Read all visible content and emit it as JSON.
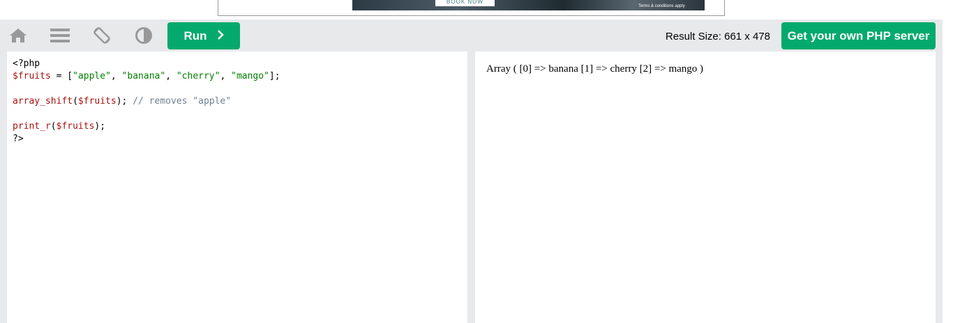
{
  "ad": {
    "button_label": "BOOK NOW",
    "terms": "Terms & conditions apply"
  },
  "toolbar": {
    "icons": [
      "home-icon",
      "menu-icon",
      "rotate-icon",
      "contrast-icon"
    ],
    "run_label": "Run",
    "result_size": "Result Size: 661 x 478",
    "server_label": "Get your own PHP server"
  },
  "editor": {
    "line1": "<?php",
    "line2_var": "$fruits",
    "line2_op": " = [",
    "line2_s1": "\"apple\"",
    "line2_s2": "\"banana\"",
    "line2_s3": "\"cherry\"",
    "line2_s4": "\"mango\"",
    "line2_end": "];",
    "line4_fn": "array_shift",
    "line4_arg": "$fruits",
    "line4_cmt": "// removes \"apple\"",
    "line6_fn": "print_r",
    "line6_arg": "$fruits",
    "line7": "?>"
  },
  "result": {
    "output": "Array ( [0] => banana [1] => cherry [2] => mango )"
  },
  "colors": {
    "accent": "#04aa6d",
    "background": "#e7e9eb"
  }
}
